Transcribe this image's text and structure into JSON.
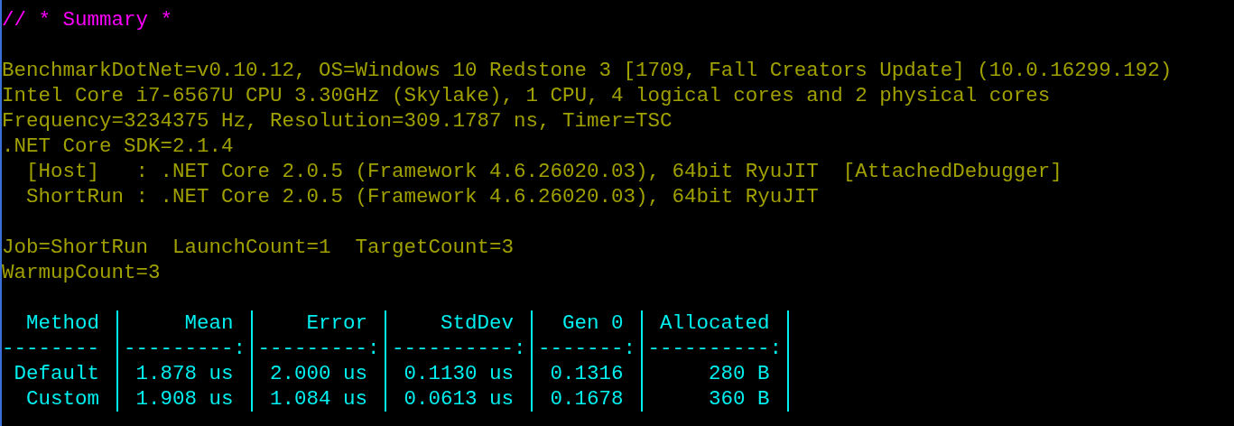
{
  "console": {
    "summary_title": "// * Summary *",
    "environment": [
      {
        "text": "BenchmarkDotNet=v0.10.12, OS=Windows 10 Redstone 3 [1709, Fall Creators Update] (10.0.16299.192)"
      },
      {
        "text": "Intel Core i7-6567U CPU 3.30GHz (Skylake), 1 CPU, 4 logical cores and 2 physical cores"
      },
      {
        "text": "Frequency=3234375 Hz, Resolution=309.1787 ns, Timer=TSC"
      },
      {
        "text": ".NET Core SDK=2.1.4",
        "children": [
          {
            "text": "[Host]   : .NET Core 2.0.5 (Framework 4.6.26020.03), 64bit RyuJIT  [AttachedDebugger]"
          },
          {
            "text": "ShortRun : .NET Core 2.0.5 (Framework 4.6.26020.03), 64bit RyuJIT"
          }
        ]
      }
    ],
    "job": [
      "Job=ShortRun  LaunchCount=1  TargetCount=3",
      "WarmupCount=3"
    ],
    "table": {
      "columns": [
        {
          "header": "Method",
          "rule": "--------"
        },
        {
          "header": "Mean",
          "rule": "---------:"
        },
        {
          "header": "Error",
          "rule": "---------:"
        },
        {
          "header": "StdDev",
          "rule": "----------:"
        },
        {
          "header": "Gen 0",
          "rule": "-------:"
        },
        {
          "header": "Allocated",
          "rule": "----------:"
        }
      ],
      "rows": [
        [
          "Default",
          "1.878 us",
          "2.000 us",
          "0.1130 us",
          "0.1316",
          "280 B"
        ],
        [
          "Custom",
          "1.908 us",
          "1.084 us",
          "0.0613 us",
          "0.1678",
          "360 B"
        ]
      ]
    }
  }
}
